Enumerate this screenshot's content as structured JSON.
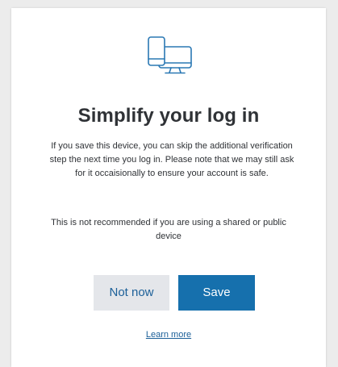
{
  "dialog": {
    "icon": "phone-and-monitor-icon",
    "title": "Simplify your log in",
    "paragraph_1": "If you save this device, you can skip the additional verification step the next time you log in. Please note that we may still ask for it occaisionally to ensure your account is safe.",
    "paragraph_2": "This is not recommended if you are using a shared or public device",
    "not_now_label": "Not now",
    "save_label": "Save",
    "learn_more_label": "Learn more"
  },
  "colors": {
    "primary": "#1670ad",
    "secondary_bg": "#e4e6ea",
    "link": "#1b5f98",
    "text": "#2f3236",
    "icon_stroke": "#2a78b4"
  }
}
